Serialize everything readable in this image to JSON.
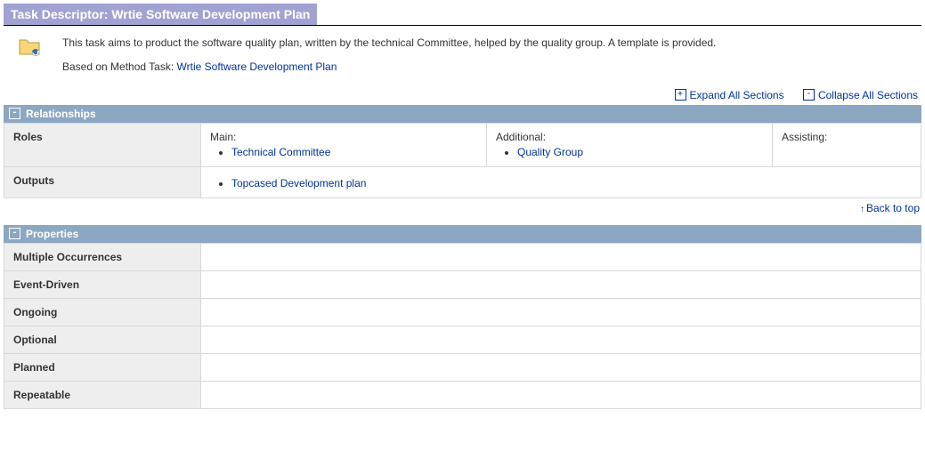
{
  "title": "Task Descriptor: Wrtie Software Development Plan",
  "summary": {
    "description": "This task aims to product the software quality plan, written by the technical Committee, helped by the quality group. A template is provided.",
    "based_on_label": "Based on Method Task: ",
    "based_on_link": "Wrtie Software Development Plan"
  },
  "actions": {
    "expand": "Expand All Sections",
    "collapse": "Collapse All Sections"
  },
  "relationships": {
    "header": "Relationships",
    "roles_label": "Roles",
    "main_label": "Main:",
    "main_item": "Technical Committee",
    "additional_label": "Additional:",
    "additional_item": "Quality Group",
    "assisting_label": "Assisting:",
    "outputs_label": "Outputs",
    "outputs_item": "Topcased Development plan"
  },
  "back_to_top": "Back to top",
  "properties": {
    "header": "Properties",
    "rows": {
      "r0": "Multiple Occurrences",
      "r1": "Event-Driven",
      "r2": "Ongoing",
      "r3": "Optional",
      "r4": "Planned",
      "r5": "Repeatable"
    }
  }
}
